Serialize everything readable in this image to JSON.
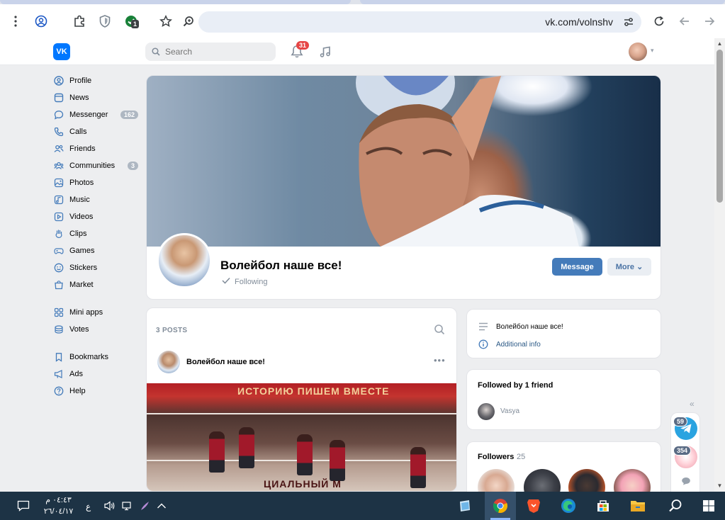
{
  "browser": {
    "url": "vk.com/volnshv",
    "extension_badge": "1"
  },
  "header": {
    "logo": "VK",
    "search_placeholder": "Search",
    "notifications_count": "31"
  },
  "menu": [
    {
      "label": "Profile",
      "icon": "profile-icon"
    },
    {
      "label": "News",
      "icon": "news-icon"
    },
    {
      "label": "Messenger",
      "icon": "messenger-icon",
      "count": "162"
    },
    {
      "label": "Calls",
      "icon": "phone-icon"
    },
    {
      "label": "Friends",
      "icon": "friends-icon"
    },
    {
      "label": "Communities",
      "icon": "communities-icon",
      "count": "3"
    },
    {
      "label": "Photos",
      "icon": "photos-icon"
    },
    {
      "label": "Music",
      "icon": "music-icon"
    },
    {
      "label": "Videos",
      "icon": "videos-icon"
    },
    {
      "label": "Clips",
      "icon": "clips-icon"
    },
    {
      "label": "Games",
      "icon": "games-icon"
    },
    {
      "label": "Stickers",
      "icon": "stickers-icon"
    },
    {
      "label": "Market",
      "icon": "market-icon"
    },
    {
      "label": "Mini apps",
      "icon": "mini-apps-icon"
    },
    {
      "label": "Votes",
      "icon": "votes-icon"
    },
    {
      "label": "Bookmarks",
      "icon": "bookmark-icon"
    },
    {
      "label": "Ads",
      "icon": "ads-icon"
    },
    {
      "label": "Help",
      "icon": "help-icon"
    }
  ],
  "group": {
    "name": "Волейбол наше все!",
    "status": "Following",
    "message_button": "Message",
    "more_button": "More"
  },
  "posts": {
    "header": "3 POSTS",
    "author": "Волейбол наше все!",
    "banner_text": "ИСТОРИЮ ПИШЕМ ВМЕСТЕ",
    "bottom_text": "ЦИАЛЬНЫЙ М"
  },
  "info": {
    "title": "Волейбол наше все!",
    "link": "Additional info"
  },
  "friends": {
    "title": "Followed by 1 friend",
    "friend_name": "Vasya"
  },
  "followers": {
    "title": "Followers",
    "count": "25"
  },
  "widgets": {
    "telegram_count": "59",
    "second_count": "354"
  },
  "taskbar": {
    "time": "٠٤:٤٣ م",
    "date": "٢٦/٠٤/١٧",
    "lang": "ع"
  },
  "colors": {
    "vk_blue": "#0077ff",
    "button_blue": "#447bba",
    "badge_red": "#e64646",
    "link_blue": "#2a5885"
  }
}
